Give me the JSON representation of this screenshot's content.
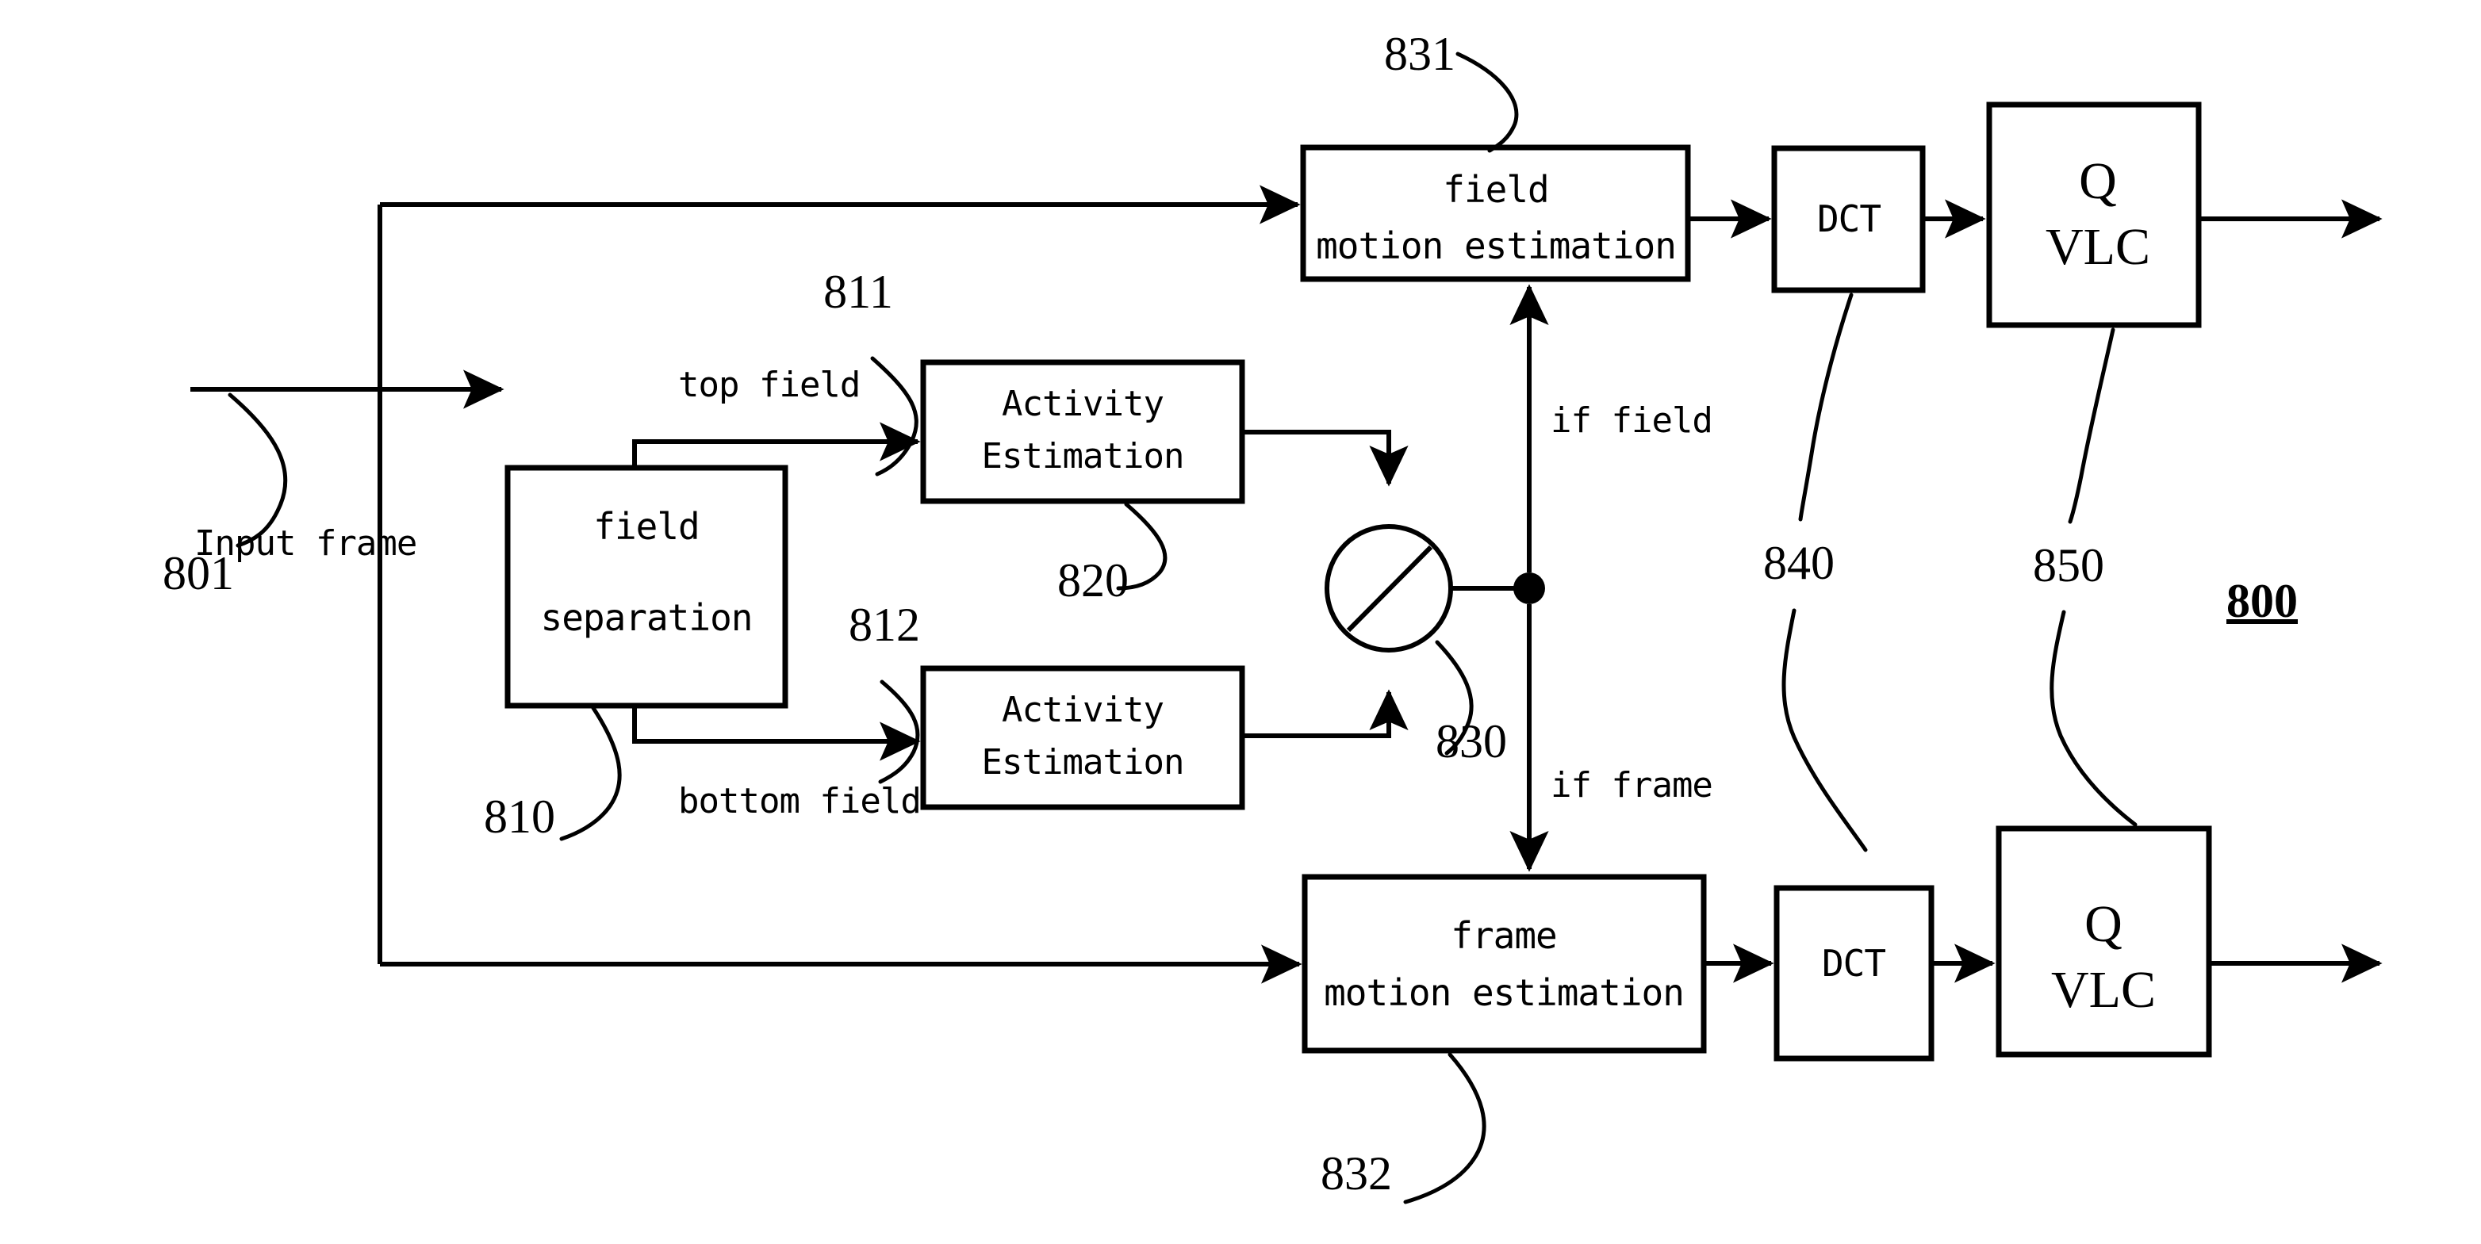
{
  "figure": {
    "label": "800",
    "blocks": {
      "field_separation": {
        "line1": "field",
        "line2": "separation",
        "ref": "810"
      },
      "activity_estimation_top": {
        "line1": "Activity",
        "line2": "Estimation",
        "ref": "820"
      },
      "activity_estimation_bottom": {
        "line1": "Activity",
        "line2": "Estimation"
      },
      "field_motion_estimation": {
        "line1": "field",
        "line2": "motion estimation",
        "ref": "831"
      },
      "frame_motion_estimation": {
        "line1": "frame",
        "line2": "motion estimation",
        "ref": "832"
      },
      "dct_top": {
        "label": "DCT",
        "ref": "840"
      },
      "dct_bottom": {
        "label": "DCT"
      },
      "qvlc_top": {
        "line1": "Q",
        "line2": "VLC",
        "ref": "850"
      },
      "qvlc_bottom": {
        "line1": "Q",
        "line2": "VLC"
      },
      "switch": {
        "ref": "830"
      }
    },
    "signals": {
      "input_frame": {
        "label": "Input frame",
        "ref": "801"
      },
      "top_field": {
        "label": "top field",
        "ref": "811"
      },
      "bottom_field": {
        "label": "bottom field",
        "ref": "812"
      },
      "if_field": {
        "label": "if field"
      },
      "if_frame": {
        "label": "if frame"
      }
    },
    "colors": {
      "stroke": "#000000",
      "fill": "#ffffff"
    }
  }
}
